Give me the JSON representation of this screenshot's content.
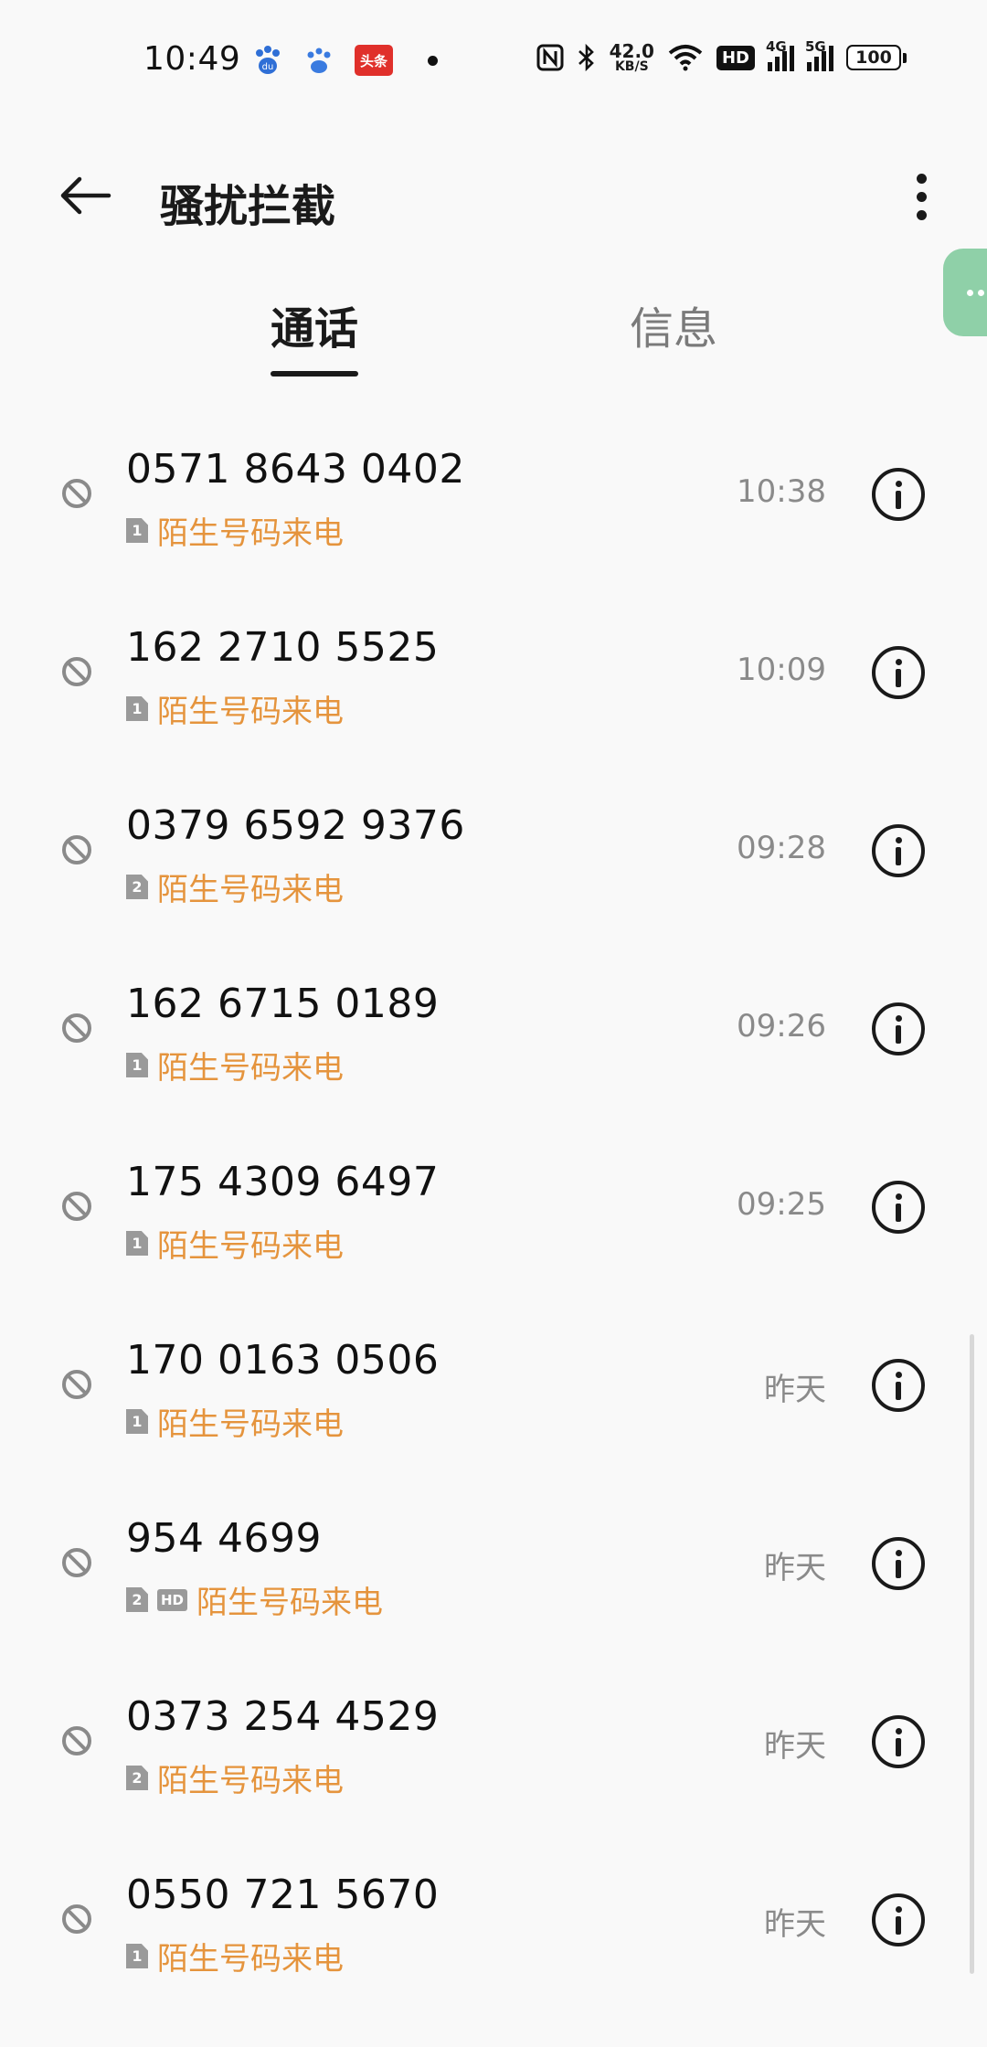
{
  "status_bar": {
    "time": "10:49",
    "toutiao_label": "头条",
    "net_speed_value": "42.0",
    "net_speed_unit": "KB/S",
    "hd_label": "HD",
    "signal1_gen": "4G",
    "signal2_gen": "5G",
    "battery": "100"
  },
  "header": {
    "title": "骚扰拦截"
  },
  "tabs": [
    {
      "label": "通话",
      "active": true
    },
    {
      "label": "信息",
      "active": false
    }
  ],
  "calls": [
    {
      "number": "0571 8643 0402",
      "sim": "1",
      "hd": false,
      "label": "陌生号码来电",
      "time": "10:38"
    },
    {
      "number": "162 2710 5525",
      "sim": "1",
      "hd": false,
      "label": "陌生号码来电",
      "time": "10:09"
    },
    {
      "number": "0379 6592 9376",
      "sim": "2",
      "hd": false,
      "label": "陌生号码来电",
      "time": "09:28"
    },
    {
      "number": "162 6715 0189",
      "sim": "1",
      "hd": false,
      "label": "陌生号码来电",
      "time": "09:26"
    },
    {
      "number": "175 4309 6497",
      "sim": "1",
      "hd": false,
      "label": "陌生号码来电",
      "time": "09:25"
    },
    {
      "number": "170 0163 0506",
      "sim": "1",
      "hd": false,
      "label": "陌生号码来电",
      "time": "昨天"
    },
    {
      "number": "954 4699",
      "sim": "2",
      "hd": true,
      "hd_label": "HD",
      "label": "陌生号码来电",
      "time": "昨天"
    },
    {
      "number": "0373 254 4529",
      "sim": "2",
      "hd": false,
      "label": "陌生号码来电",
      "time": "昨天"
    },
    {
      "number": "0550 721 5670",
      "sim": "1",
      "hd": false,
      "label": "陌生号码来电",
      "time": "昨天"
    }
  ],
  "colors": {
    "label_accent": "#e5943d",
    "floating_ball": "#8fd0a8"
  }
}
